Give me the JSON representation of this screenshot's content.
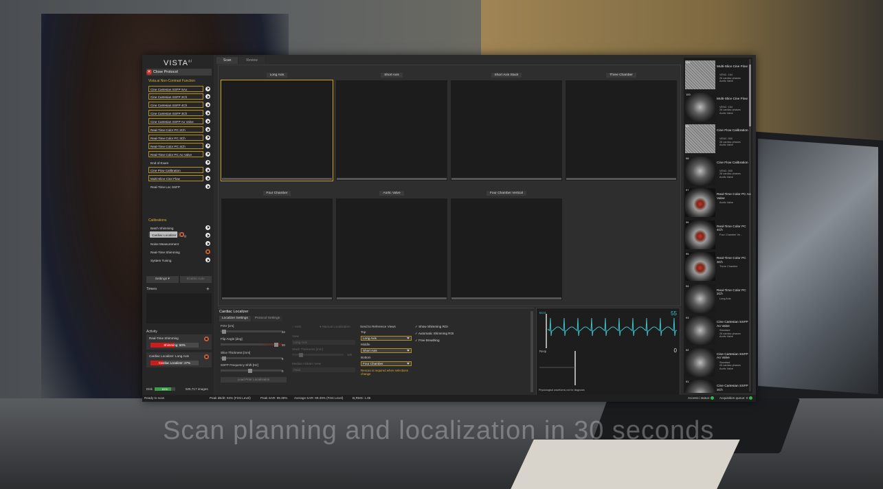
{
  "app": {
    "logo": "VISTA",
    "logo_sup": "ai",
    "close_protocol": "Close Protocol"
  },
  "protocol": {
    "section_title": "Vista.ai Non-Contrast Function",
    "items": [
      {
        "label": "Cine Cartesian SSFP SAx",
        "state": "highlight"
      },
      {
        "label": "Cine Cartesian SSFP 2Ch",
        "state": "highlight"
      },
      {
        "label": "Cine Cartesian SSFP 4Ch",
        "state": "highlight"
      },
      {
        "label": "Cine Cartesian SSFP 3Ch",
        "state": "highlight"
      },
      {
        "label": "Cine Cartesian SSFP Ao Valve",
        "state": "highlight"
      },
      {
        "label": "Real-Time Color PC 2Ch",
        "state": "highlight"
      },
      {
        "label": "Real-Time Color PC 3Ch",
        "state": "highlight"
      },
      {
        "label": "Real-Time Color PC 4Ch",
        "state": "highlight"
      },
      {
        "label": "Real-Time Color PC Ao Valve",
        "state": "highlight"
      },
      {
        "label": "End of Exam",
        "state": "normal"
      },
      {
        "label": "Cine Flow Calibration",
        "state": "highlight"
      },
      {
        "label": "Multi-Slice Cine Flow",
        "state": "highlight"
      },
      {
        "label": "Real-Time Loc SSFP",
        "state": "normal"
      }
    ]
  },
  "calibrations": {
    "section_title": "Calibrations",
    "items": [
      {
        "label": "Batch Shimming",
        "state": "normal",
        "icon": "play"
      },
      {
        "label": "Cardiac Localizer",
        "state": "selected",
        "icon": "stop"
      },
      {
        "label": "Center Frequency Tuning",
        "state": "normal",
        "icon": "play"
      },
      {
        "label": "Noise Measurement",
        "state": "normal",
        "icon": "play"
      },
      {
        "label": "Real-Time Shimming",
        "state": "normal",
        "icon": "stop"
      },
      {
        "label": "System Tuning",
        "state": "normal",
        "icon": "play"
      }
    ]
  },
  "sidebar_buttons": {
    "settings": "Settings ▾",
    "enable_auto": "Enable Auto"
  },
  "timers": {
    "label": "Timers",
    "add": "+"
  },
  "activity": {
    "label": "Activity",
    "items": [
      {
        "title": "Real-Time Shimming",
        "bar_text": "Shimming: 50%",
        "progress": 0.5
      },
      {
        "title": "Cardiac Localizer: Long Axis",
        "bar_text": "Cardiac Localizer: 27%",
        "progress": 0.27
      }
    ]
  },
  "disk": {
    "label": "Disk",
    "percent_text": "81%",
    "progress": 0.81,
    "images": "525,717 images"
  },
  "tabs": [
    {
      "label": "Scan",
      "active": true
    },
    {
      "label": "Review",
      "active": false
    }
  ],
  "viewports": [
    {
      "title": "Long Axis",
      "active": true
    },
    {
      "title": "Short Axis",
      "active": false
    },
    {
      "title": "Short Axis Stack",
      "active": false
    },
    {
      "title": "Three Chamber",
      "active": false
    },
    {
      "title": "Four Chamber",
      "active": false
    },
    {
      "title": "Aortic Valve",
      "active": false
    },
    {
      "title": "Four Chamber Vertical",
      "active": false
    }
  ],
  "localizer": {
    "title": "Cardiac Localizer",
    "tabs": [
      "Localizer Settings",
      "Protocol Settings"
    ],
    "fov_label": "FOV [cm]",
    "fov_value": "32",
    "flip_label": "Flip Angle [deg]",
    "flip_value": "30",
    "slice_label": "Slice Thickness [mm]",
    "slice_value": "6",
    "ssfp_label": "SSFP Frequency Shift [Hz]",
    "ssfp_value": "0",
    "load_prior": "Load Prior Localization",
    "auto_label": "Auto",
    "manual_label": "Manual Localization",
    "view_label": "View",
    "view_value": "Long Axis",
    "stack_label": "Stack Thickness [mm]",
    "stack_value": "100",
    "median_label": "Median Hidden View",
    "median_value": "Axial",
    "send_label": "Send to Reference Views",
    "top_label": "Top",
    "top_value": "Long Axis",
    "middle_label": "Middle",
    "middle_value": "Short Axis",
    "bottom_label": "Bottom",
    "bottom_value": "Four Chamber",
    "rescan_warning": "Rescan is required when selections change",
    "check_show_roi": "✓ Show Shimming ROI",
    "check_auto_roi": "✓ Automatic Shimming ROI",
    "check_free_breath": "✓ Free Breathing"
  },
  "physio": {
    "ecg_label": "ECG",
    "ecg_value": "55",
    "resp_label": "Resp",
    "resp_value": "0",
    "footer": "Physiological waveforms not for diagnosis",
    "ecg_color": "#3fc0c8"
  },
  "thumbnails": [
    {
      "num": "101",
      "name": "Multi-Slice Cine Flow",
      "sub": [
        "VENC: 164",
        "26 cardiac phases",
        "Aortic Valve"
      ],
      "img": "noise"
    },
    {
      "num": "100",
      "name": "Multi-Slice Cine Flow",
      "sub": [
        "VENC: 164",
        "26 cardiac phases",
        "Aortic Valve"
      ],
      "img": "gray"
    },
    {
      "num": "99",
      "name": "Cine Flow Calibration",
      "sub": [
        "VENC: 500",
        "26 cardiac phases",
        "Aortic Valve"
      ],
      "img": "noise"
    },
    {
      "num": "98",
      "name": "Cine Flow Calibration",
      "sub": [
        "VENC: 500",
        "26 cardiac phases",
        "Aortic Valve"
      ],
      "img": "gray"
    },
    {
      "num": "97",
      "name": "Real-Time Color PC Ao Valve",
      "sub": [
        "Aortic Valve"
      ],
      "img": "color"
    },
    {
      "num": "96",
      "name": "Real-Time Color PC 4Ch",
      "sub": [
        "Four Chamber Ve..."
      ],
      "img": "color"
    },
    {
      "num": "95",
      "name": "Real-Time Color PC 3Ch",
      "sub": [
        "Three Chamber"
      ],
      "img": "color"
    },
    {
      "num": "94",
      "name": "Real-Time Color PC 2Ch",
      "sub": [
        "Long Axis"
      ],
      "img": "gray"
    },
    {
      "num": "93",
      "name": "Cine Cartesian SSFP Ao Valve",
      "sub": [
        "Standard",
        "26 cardiac phases",
        "Aortic Valve"
      ],
      "img": "gray"
    },
    {
      "num": "92",
      "name": "Cine Cartesian SSFP Ao Valve",
      "sub": [
        "Standard",
        "26 cardiac phases",
        "Aortic Valve"
      ],
      "img": "gray"
    },
    {
      "num": "91",
      "name": "Cine Cartesian SSFP 3Ch",
      "sub": [
        "Standard"
      ],
      "img": "gray"
    }
  ],
  "status": {
    "ready": "Ready to scan",
    "peak_dbdt": "Peak dB/dt: 94% (First Level)",
    "peak_sar": "Peak SAR: 99.39%",
    "avg_sar": "Average SAR: 99.39% (First Level)",
    "b1rms": "B₁RMS: 1.85",
    "access": "Access-i status:",
    "queue": "Acquisition queue: 0"
  },
  "caption": "Scan planning and localization in 30 seconds"
}
